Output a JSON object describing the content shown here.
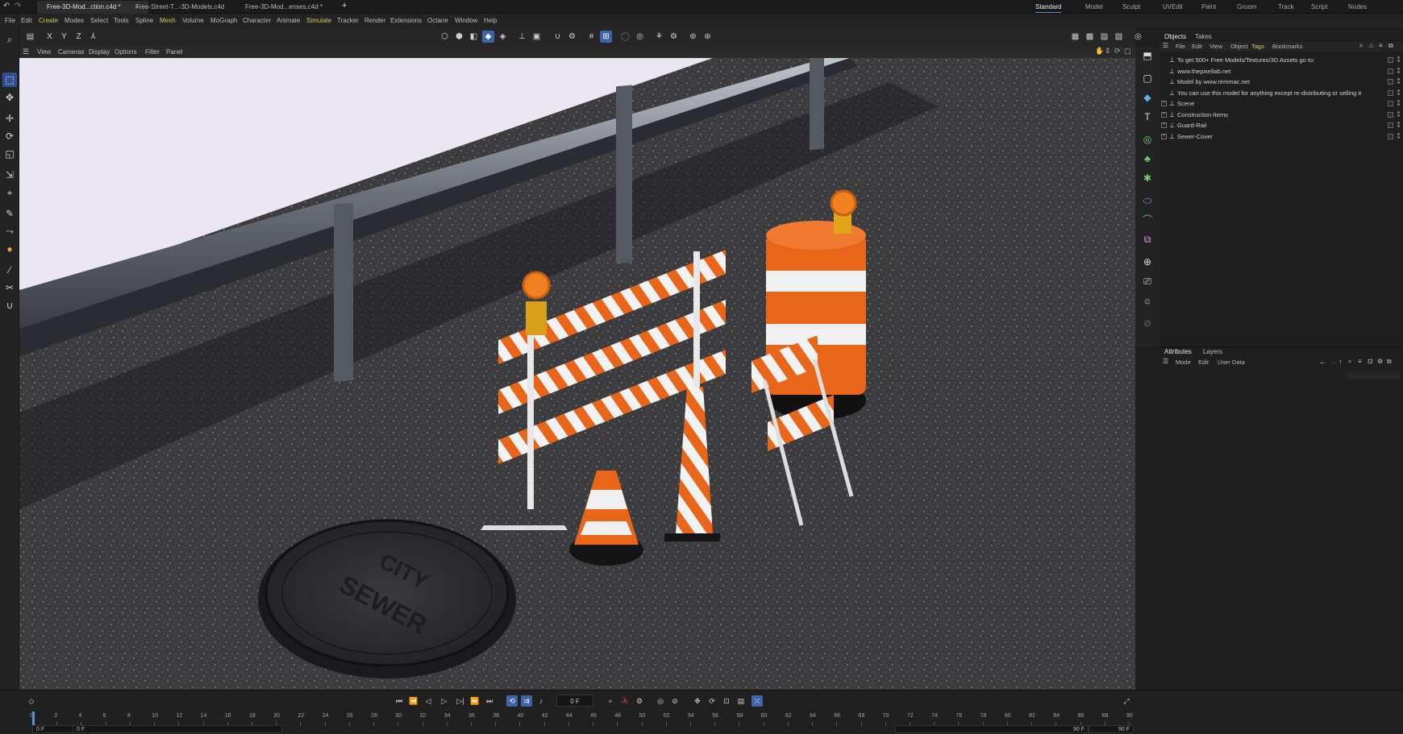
{
  "window_tabs": [
    {
      "label": "Free-3D-Mod...ction.c4d *",
      "active": true,
      "closable": true
    },
    {
      "label": "Free-Street-T...-3D-Models.c4d",
      "active": false
    },
    {
      "label": "Free-3D-Mod...enses.c4d *",
      "active": false
    }
  ],
  "new_tab_label": "+",
  "layouts": [
    "Standard",
    "Model",
    "Sculpt",
    "UVEdit",
    "Paint",
    "Groom",
    "Track",
    "Script",
    "Nodes"
  ],
  "active_layout": "Standard",
  "menu": [
    "File",
    "Edit",
    "Create",
    "Modes",
    "Select",
    "Tools",
    "Spline",
    "Mesh",
    "Volume",
    "MoGraph",
    "Character",
    "Animate",
    "Simulate",
    "Tracker",
    "Render",
    "Extensions",
    "Octane",
    "Window",
    "Help"
  ],
  "highlighted_menus": [
    "Create",
    "Mesh",
    "Simulate"
  ],
  "axis_toggles": [
    "X",
    "Y",
    "Z"
  ],
  "viewport_menu": [
    "View",
    "Cameras",
    "Display",
    "Options",
    "Filter",
    "Panel"
  ],
  "objects_panel": {
    "tabs": [
      "Objects",
      "Takes"
    ],
    "menu": [
      "File",
      "Edit",
      "View",
      "Object",
      "Tags",
      "Bookmarks"
    ],
    "rows": [
      {
        "label": "To get 500+ Free Models/Textures/3D Assets go to:",
        "expandable": false
      },
      {
        "label": "www.thepixellab.net",
        "expandable": false
      },
      {
        "label": "Model by www.remmac.net",
        "expandable": false
      },
      {
        "label": "You can use this model for anything except re-distributing or selling it",
        "expandable": false
      },
      {
        "label": "Scene",
        "expandable": true
      },
      {
        "label": "Construction-Items",
        "expandable": true
      },
      {
        "label": "Guard-Rail",
        "expandable": true
      },
      {
        "label": "Sewer-Cover",
        "expandable": true
      }
    ]
  },
  "attributes_panel": {
    "tabs": [
      "Attributes",
      "Layers"
    ],
    "menu": [
      "Mode",
      "Edit",
      "User Data"
    ]
  },
  "timeline": {
    "current_frame": "0 F",
    "ticks": [
      "0",
      "2",
      "4",
      "6",
      "8",
      "10",
      "12",
      "14",
      "16",
      "18",
      "20",
      "22",
      "24",
      "26",
      "28",
      "30",
      "32",
      "34",
      "36",
      "38",
      "40",
      "42",
      "44",
      "46",
      "48",
      "50",
      "52",
      "54",
      "56",
      "58",
      "60",
      "62",
      "64",
      "66",
      "68",
      "70",
      "72",
      "74",
      "76",
      "78",
      "80",
      "82",
      "84",
      "86",
      "88",
      "90"
    ],
    "start_left": "0 F",
    "start_right": "0 F",
    "end_left": "90 F",
    "end_right": "90 F"
  },
  "scene_text": {
    "sewer_line1": "CITY",
    "sewer_line2": "SEWER"
  },
  "colors": {
    "accent": "#3d63a8",
    "orange": "#e8651a",
    "asphalt": "#3a3a3c",
    "sky": "#ece6f2"
  }
}
